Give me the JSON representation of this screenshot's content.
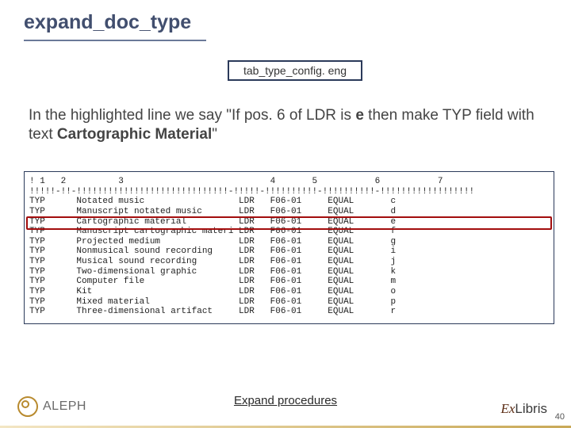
{
  "title": "expand_doc_type",
  "file_label": "tab_type_config. eng",
  "description_html": "In the highlighted line we say \"If pos. 6 of LDR is <b>e</b> then make TYP field with text <b>Cartographic Material</b>\"",
  "table": {
    "ruler": "! 1   2          3                            4       5           6           7",
    "divider": "!!!!!-!!-!!!!!!!!!!!!!!!!!!!!!!!!!!!!!-!!!!!-!!!!!!!!!!-!!!!!!!!!!-!!!!!!!!!!!!!!!!!!",
    "rows": [
      {
        "c1": "TYP",
        "c3": "Notated music",
        "c4": "LDR",
        "c5": "F06-01",
        "c6": "EQUAL",
        "c7": "c"
      },
      {
        "c1": "TYP",
        "c3": "Manuscript notated music",
        "c4": "LDR",
        "c5": "F06-01",
        "c6": "EQUAL",
        "c7": "d"
      },
      {
        "c1": "TYP",
        "c3": "Cartographic material",
        "c4": "LDR",
        "c5": "F06-01",
        "c6": "EQUAL",
        "c7": "e"
      },
      {
        "c1": "TYP",
        "c3": "Manuscript cartographic materi",
        "c4": "LDR",
        "c5": "F06-01",
        "c6": "EQUAL",
        "c7": "f"
      },
      {
        "c1": "TYP",
        "c3": "Projected medium",
        "c4": "LDR",
        "c5": "F06-01",
        "c6": "EQUAL",
        "c7": "g"
      },
      {
        "c1": "TYP",
        "c3": "Nonmusical sound recording",
        "c4": "LDR",
        "c5": "F06-01",
        "c6": "EQUAL",
        "c7": "i"
      },
      {
        "c1": "TYP",
        "c3": "Musical sound recording",
        "c4": "LDR",
        "c5": "F06-01",
        "c6": "EQUAL",
        "c7": "j"
      },
      {
        "c1": "TYP",
        "c3": "Two-dimensional graphic",
        "c4": "LDR",
        "c5": "F06-01",
        "c6": "EQUAL",
        "c7": "k"
      },
      {
        "c1": "TYP",
        "c3": "Computer file",
        "c4": "LDR",
        "c5": "F06-01",
        "c6": "EQUAL",
        "c7": "m"
      },
      {
        "c1": "TYP",
        "c3": "Kit",
        "c4": "LDR",
        "c5": "F06-01",
        "c6": "EQUAL",
        "c7": "o"
      },
      {
        "c1": "TYP",
        "c3": "Mixed material",
        "c4": "LDR",
        "c5": "F06-01",
        "c6": "EQUAL",
        "c7": "p"
      },
      {
        "c1": "TYP",
        "c3": "Three-dimensional artifact",
        "c4": "LDR",
        "c5": "F06-01",
        "c6": "EQUAL",
        "c7": "r"
      }
    ],
    "highlight_index": 2
  },
  "footer_link": "Expand procedures",
  "page_number": "40",
  "logos": {
    "left": "ALEPH",
    "right_prefix": "Ex",
    "right_suffix": "Libris"
  }
}
